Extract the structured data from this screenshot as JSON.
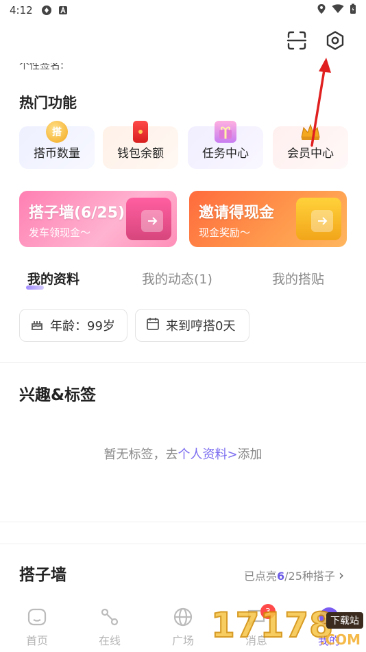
{
  "status_bar": {
    "time": "4:12"
  },
  "header": {
    "cut_text": "个性签名:"
  },
  "hot_features": {
    "title": "热门功能",
    "items": [
      {
        "label": "搭币数量",
        "icon": "coin-icon",
        "icon_text": "搭"
      },
      {
        "label": "钱包余额",
        "icon": "red-envelope-icon"
      },
      {
        "label": "任务中心",
        "icon": "gift-icon"
      },
      {
        "label": "会员中心",
        "icon": "crown-icon"
      }
    ]
  },
  "banners": [
    {
      "title": "搭子墙(6/25)",
      "subtitle": "发车领现金～"
    },
    {
      "title": "邀请得现金",
      "subtitle": "现金奖励～"
    }
  ],
  "tabs": [
    {
      "label": "我的资料",
      "active": true
    },
    {
      "label": "我的动态(1)",
      "active": false
    },
    {
      "label": "我的搭贴",
      "active": false
    }
  ],
  "info_chips": [
    {
      "label": "年龄：99岁",
      "icon": "cake-icon"
    },
    {
      "label": "来到哼搭0天",
      "icon": "calendar-icon"
    }
  ],
  "interests": {
    "title": "兴趣&标签",
    "empty_prefix": "暂无标签，去",
    "empty_link": "个人资料>",
    "empty_suffix": "添加"
  },
  "partner_wall": {
    "title": "搭子墙",
    "more_prefix": "已点亮",
    "more_count": "6",
    "more_suffix": "/25种搭子",
    "more_chevron": "›"
  },
  "bottom_nav": [
    {
      "label": "首页",
      "icon": "home-icon",
      "active": false
    },
    {
      "label": "在线",
      "icon": "route-icon",
      "active": false
    },
    {
      "label": "广场",
      "icon": "globe-icon",
      "active": false
    },
    {
      "label": "消息",
      "icon": "message-icon",
      "active": false,
      "badge": "3"
    },
    {
      "label": "我的",
      "icon": "profile-icon",
      "active": true
    }
  ],
  "watermark": {
    "number": "17178",
    "tag": "下载站",
    "suffix": ".COM"
  },
  "colors": {
    "accent": "#7b5cf2",
    "annotation_arrow": "#e02020"
  }
}
